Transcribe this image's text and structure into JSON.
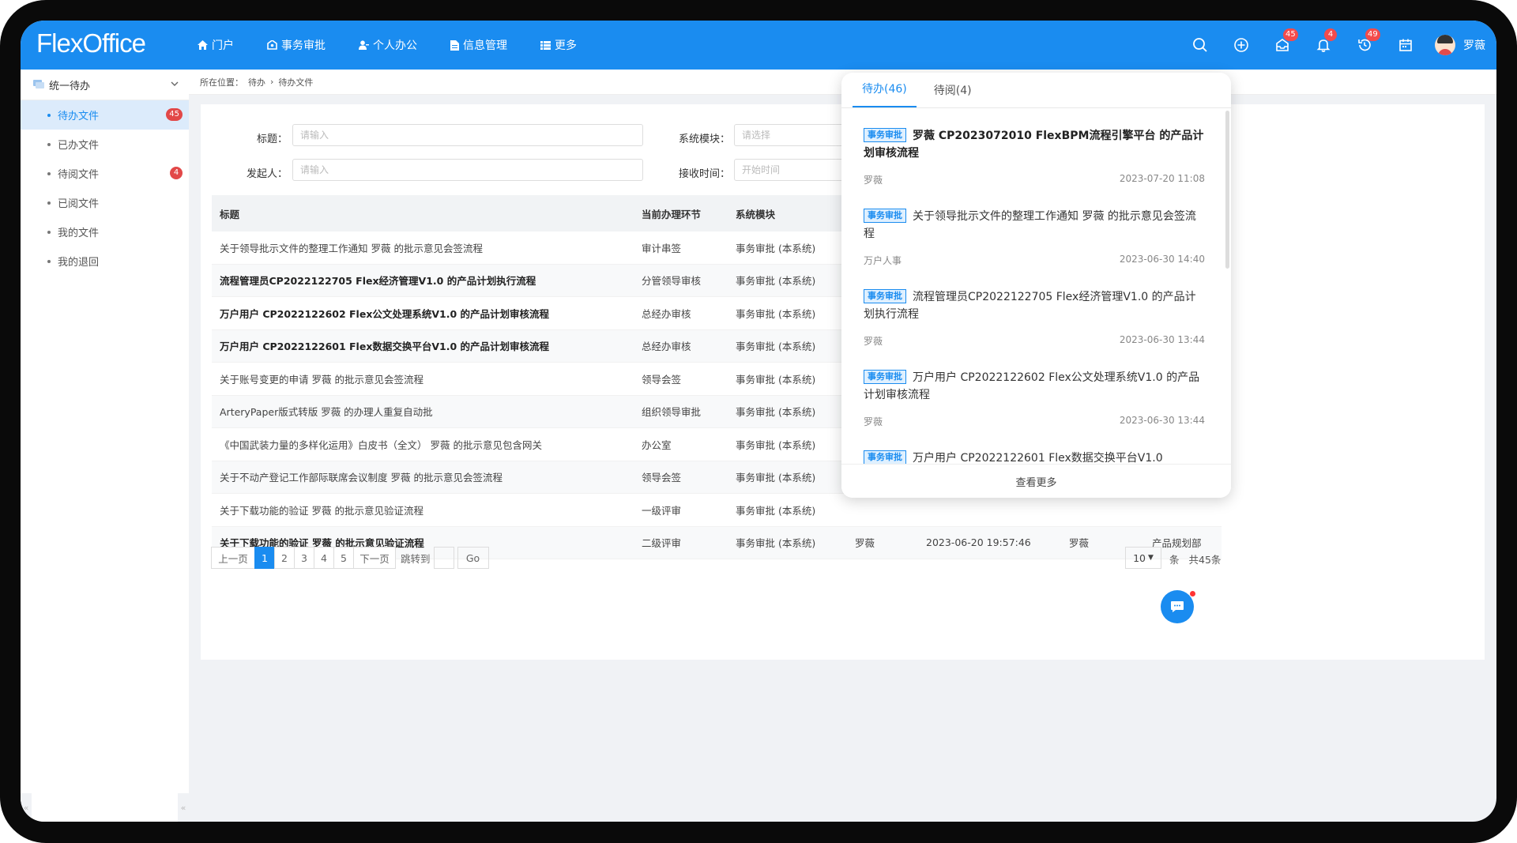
{
  "app": {
    "logo": "FlexOffice"
  },
  "nav": [
    {
      "label": "门户",
      "icon": "home-icon"
    },
    {
      "label": "事务审批",
      "icon": "approval-icon"
    },
    {
      "label": "个人办公",
      "icon": "person-icon"
    },
    {
      "label": "信息管理",
      "icon": "document-icon"
    },
    {
      "label": "更多",
      "icon": "grid-icon"
    }
  ],
  "top_icons": [
    {
      "name": "search-icon",
      "badge": ""
    },
    {
      "name": "add-circle-icon",
      "badge": ""
    },
    {
      "name": "inbox-icon",
      "badge": "45"
    },
    {
      "name": "bell-icon",
      "badge": "4"
    },
    {
      "name": "history-icon",
      "badge": "49"
    },
    {
      "name": "calendar-icon",
      "badge": ""
    }
  ],
  "user": {
    "name": "罗薇"
  },
  "sidebar": {
    "header": "统一待办",
    "items": [
      {
        "label": "待办文件",
        "badge": "45",
        "active": true
      },
      {
        "label": "已办文件",
        "badge": ""
      },
      {
        "label": "待阅文件",
        "badge": "4"
      },
      {
        "label": "已阅文件",
        "badge": ""
      },
      {
        "label": "我的文件",
        "badge": ""
      },
      {
        "label": "我的退回",
        "badge": ""
      }
    ],
    "collapse_left": "«",
    "collapse_right": "«"
  },
  "breadcrumb": {
    "prefix": "所在位置：",
    "items": [
      "待办",
      "待办文件"
    ]
  },
  "search": {
    "title_label": "标题：",
    "title_placeholder": "请输入",
    "module_label": "系统模块：",
    "module_placeholder": "请选择",
    "initiator_label": "发起人：",
    "initiator_placeholder": "请输入",
    "received_label": "接收时间：",
    "received_placeholder": "开始时间"
  },
  "table": {
    "headers": [
      "标题",
      "当前办理环节",
      "系统模块",
      "",
      "",
      "",
      ""
    ],
    "rows": [
      {
        "title": "关于领导批示文件的整理工作通知 罗薇 的批示意见会签流程",
        "step": "审计串签",
        "module": "事务审批 (本系统)",
        "initiator": "",
        "time": "",
        "handler": "",
        "dept": "",
        "bold": false
      },
      {
        "title": "流程管理员CP2022122705 Flex经济管理V1.0 的产品计划执行流程",
        "step": "分管领导审核",
        "module": "事务审批 (本系统)",
        "initiator": "",
        "time": "",
        "handler": "",
        "dept": "",
        "bold": true
      },
      {
        "title": "万户用户 CP2022122602 Flex公文处理系统V1.0 的产品计划审核流程",
        "step": "总经办审核",
        "module": "事务审批 (本系统)",
        "initiator": "",
        "time": "",
        "handler": "",
        "dept": "",
        "bold": true
      },
      {
        "title": "万户用户 CP2022122601 Flex数据交换平台V1.0 的产品计划审核流程",
        "step": "总经办审核",
        "module": "事务审批 (本系统)",
        "initiator": "",
        "time": "",
        "handler": "",
        "dept": "",
        "bold": true
      },
      {
        "title": "关于账号变更的申请 罗薇 的批示意见会签流程",
        "step": "领导会签",
        "module": "事务审批 (本系统)",
        "initiator": "",
        "time": "",
        "handler": "",
        "dept": "",
        "bold": false
      },
      {
        "title": "ArteryPaper版式转版 罗薇 的办理人重复自动批",
        "step": "组织领导审批",
        "module": "事务审批 (本系统)",
        "initiator": "",
        "time": "",
        "handler": "",
        "dept": "",
        "bold": false
      },
      {
        "title": "《中国武装力量的多样化运用》白皮书（全文） 罗薇 的批示意见包含网关",
        "step": "办公室",
        "module": "事务审批 (本系统)",
        "initiator": "",
        "time": "",
        "handler": "",
        "dept": "",
        "bold": false
      },
      {
        "title": "关于不动产登记工作部际联席会议制度 罗薇 的批示意见会签流程",
        "step": "领导会签",
        "module": "事务审批 (本系统)",
        "initiator": "",
        "time": "",
        "handler": "",
        "dept": "",
        "bold": false
      },
      {
        "title": "关于下载功能的验证 罗薇 的批示意见验证流程",
        "step": "一级评审",
        "module": "事务审批 (本系统)",
        "initiator": "",
        "time": "",
        "handler": "",
        "dept": "",
        "bold": false
      },
      {
        "title": "关于下载功能的验证 罗薇 的批示意见验证流程",
        "step": "二级评审",
        "module": "事务审批 (本系统)",
        "initiator": "罗薇",
        "time": "2023-06-20 19:57:46",
        "handler": "罗薇",
        "dept": "产品规划部",
        "bold": true
      }
    ]
  },
  "pagination": {
    "prev": "上一页",
    "pages": [
      "1",
      "2",
      "3",
      "4",
      "5"
    ],
    "current": "1",
    "next": "下一页",
    "jump_label": "跳转到",
    "go": "Go",
    "page_size": "10",
    "unit": "条",
    "total": "共45条"
  },
  "popup": {
    "tabs": [
      {
        "label": "待办(46)",
        "active": true
      },
      {
        "label": "待阅(4)",
        "active": false
      }
    ],
    "items": [
      {
        "tag": "事务审批",
        "title": "罗薇 CP2023072010 FlexBPM流程引擎平台 的产品计划审核流程",
        "sender": "罗薇",
        "time": "2023-07-20 11:08",
        "bold": true
      },
      {
        "tag": "事务审批",
        "title": "关于领导批示文件的整理工作通知 罗薇 的批示意见会签流程",
        "sender": "万户人事",
        "time": "2023-06-30 14:40",
        "bold": false
      },
      {
        "tag": "事务审批",
        "title": "流程管理员CP2022122705 Flex经济管理V1.0 的产品计划执行流程",
        "sender": "罗薇",
        "time": "2023-06-30 13:44",
        "bold": false
      },
      {
        "tag": "事务审批",
        "title": "万户用户 CP2022122602 Flex公文处理系统V1.0 的产品计划审核流程",
        "sender": "罗薇",
        "time": "2023-06-30 13:44",
        "bold": false
      },
      {
        "tag": "事务审批",
        "title": "万户用户 CP2022122601 Flex数据交换平台V1.0",
        "sender": "",
        "time": "",
        "bold": false
      }
    ],
    "more": "查看更多"
  },
  "colors": {
    "primary": "#1a8cf0",
    "badge": "#e24848"
  }
}
